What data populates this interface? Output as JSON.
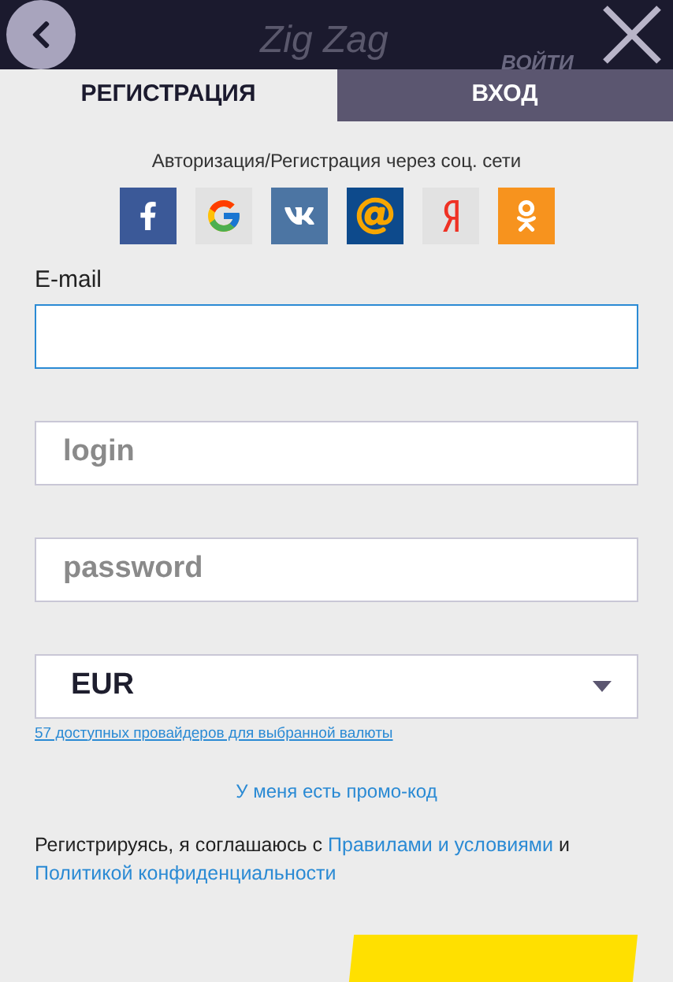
{
  "header": {
    "logo": "Zig Zag",
    "login_link": "ВОЙТИ"
  },
  "tabs": [
    {
      "label": "РЕГИСТРАЦИЯ",
      "selected": true
    },
    {
      "label": "ВХОД",
      "selected": false
    }
  ],
  "social": {
    "caption": "Авторизация/Регистрация через соц. сети",
    "networks": [
      {
        "kind": "facebook"
      },
      {
        "kind": "google"
      },
      {
        "kind": "vk"
      },
      {
        "kind": "mail"
      },
      {
        "kind": "yandex"
      },
      {
        "kind": "ok"
      }
    ]
  },
  "fields": [
    {
      "label": "E-mail",
      "focused": true
    },
    {
      "placeholder": "login",
      "focused": false
    },
    {
      "placeholder": "password",
      "focused": false
    }
  ],
  "currency": {
    "value": "EUR",
    "providers_link": "57 доступных провайдеров для выбранной валюты"
  },
  "promo_link": "У меня есть промо-код",
  "terms": {
    "text": "Регистрируясь, я соглашаюсь с",
    "rules_link": "Правилами и условиями",
    "and": "и",
    "privacy_link": "Политикой конфиденциальности"
  }
}
